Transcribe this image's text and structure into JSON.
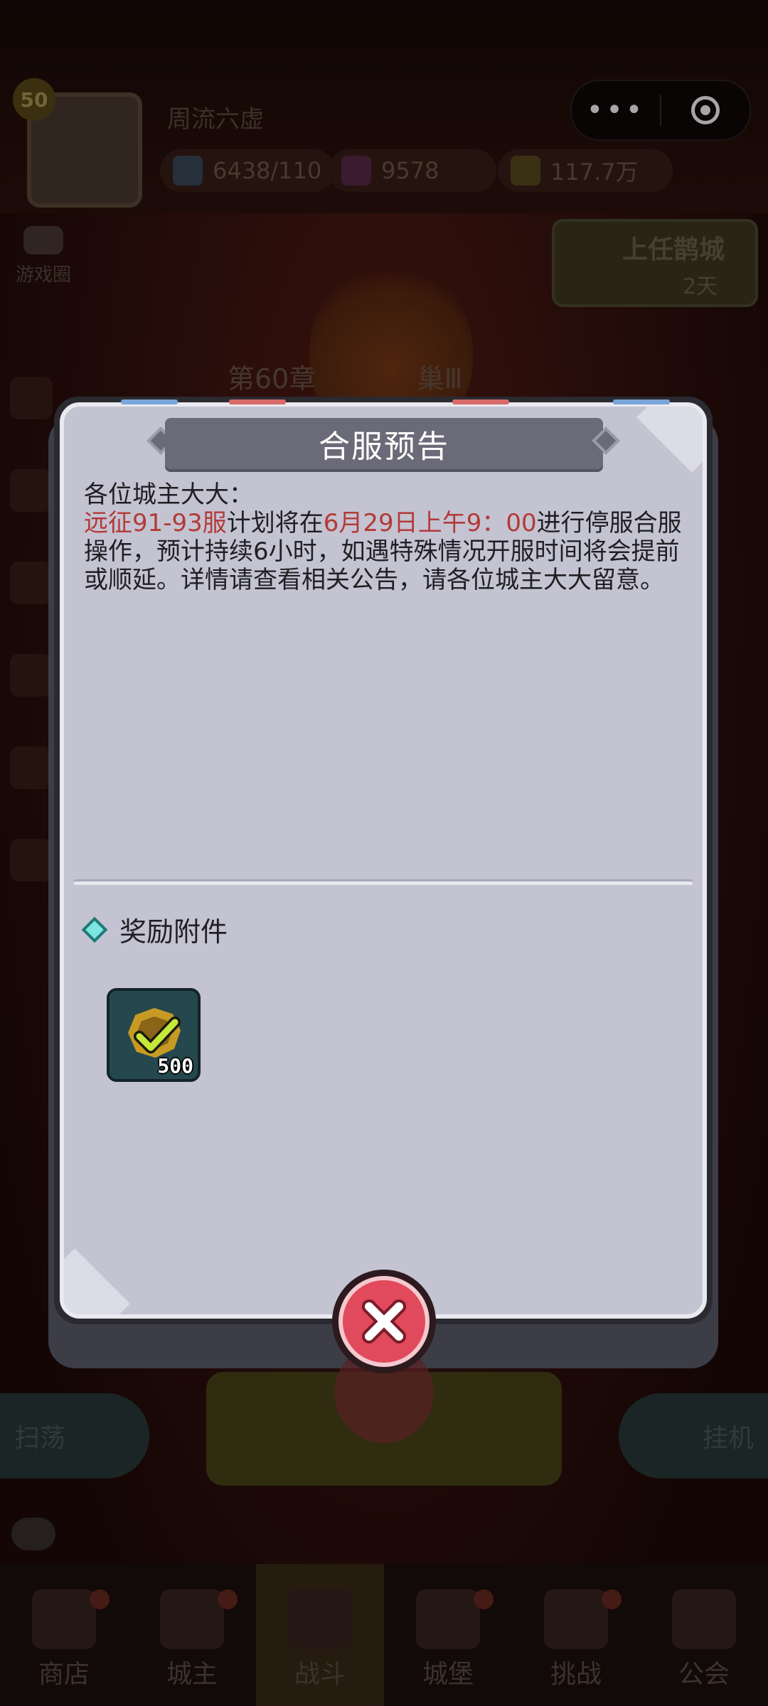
{
  "background": {
    "player": {
      "level": "50",
      "name": "周流六虚"
    },
    "resources": [
      {
        "icon": "energy-icon",
        "value": "6438/110"
      },
      {
        "icon": "gem-icon",
        "value": "9578"
      },
      {
        "icon": "gold-icon",
        "value": "117.7万"
      }
    ],
    "game_circle_label": "游戏圈",
    "promo": {
      "title": "上任鹊城",
      "days": "2天"
    },
    "chapter": "第60章",
    "chapter_suffix": "巢Ⅲ",
    "bottom_left_button": "扫荡",
    "bottom_right_button": "挂机",
    "nav": [
      {
        "label": "商店",
        "icon": "shop-icon",
        "dot": true
      },
      {
        "label": "城主",
        "icon": "crown-icon",
        "dot": true
      },
      {
        "label": "战斗",
        "icon": "swords-icon",
        "dot": false
      },
      {
        "label": "城堡",
        "icon": "castle-icon",
        "dot": true
      },
      {
        "label": "挑战",
        "icon": "challenge-icon",
        "dot": true
      },
      {
        "label": "公会",
        "icon": "guild-icon",
        "dot": false
      }
    ]
  },
  "dialog": {
    "title": "合服预告",
    "notice": {
      "greeting": "各位城主大大：",
      "highlight_server": "远征91-93服",
      "part1": "计划将在",
      "highlight_time": "6月29日上午9：00",
      "part2": "进行停服合服操作，预计持续6小时，如遇特殊情况开服时间将会提前或顺延。详情请查看相关公告，请各位城主大大留意。"
    },
    "reward_title": "奖励附件",
    "rewards": [
      {
        "icon": "gold-badge-check-icon",
        "count": "500"
      }
    ]
  },
  "colors": {
    "highlight": "#b33a37",
    "close_button": "#e14a5c",
    "panel": "#c4c3d2"
  }
}
